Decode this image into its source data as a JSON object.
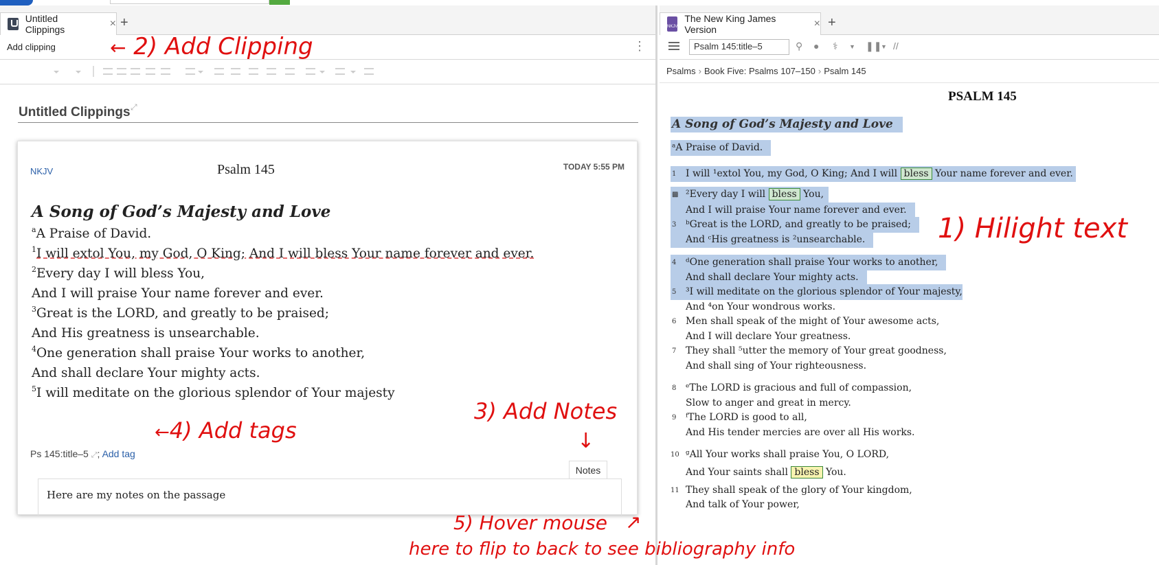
{
  "left": {
    "tab_title": "Untitled Clippings",
    "tab_close": "×",
    "tab_add": "+",
    "add_clipping": "Add clipping",
    "kebab": "⋮",
    "doc_title": "Untitled Clippings",
    "doc_title_edit": "⤢",
    "card": {
      "version": "NKJV",
      "reference": "Psalm 145",
      "timestamp": "TODAY 5:55 PM",
      "heading": "A Song of God’s Majesty and Love",
      "lines": [
        {
          "sup": "a",
          "text": "A Praise of David."
        },
        {
          "sup": "1",
          "text": "I will extol You, my God, O King; And I will bless Your name forever and ever."
        },
        {
          "sup": "2",
          "text": "Every day I will bless You,"
        },
        {
          "sup": "",
          "text": "And I will praise Your name forever and ever."
        },
        {
          "sup": "3",
          "text": "Great is the LORD, and greatly to be praised;"
        },
        {
          "sup": "",
          "text": "And His greatness is unsearchable."
        },
        {
          "sup": "4",
          "text": "One generation shall praise Your works to another,"
        },
        {
          "sup": "",
          "text": "And shall declare Your mighty acts."
        },
        {
          "sup": "5",
          "text": "I will meditate on the glorious splendor of Your majesty"
        }
      ],
      "tag_ref": "Ps 145:title–5",
      "tag_edit": "⤢",
      "tag_sep": "; ",
      "add_tag": "Add tag",
      "notes_tab": "Notes",
      "notes_text": "Here are my notes on the passage"
    }
  },
  "right": {
    "tab_title": "The New King James Version",
    "tab_close": "×",
    "tab_add": "+",
    "book_icon_text": "NKJV",
    "reference_input": "Psalm 145:title–5",
    "breadcrumb": [
      "Psalms",
      "Book Five: Psalms 107–150",
      "Psalm 145"
    ],
    "crumb_sep": "›",
    "psalm_title": "PSALM 145",
    "heading": "A Song of God’s Majesty and Love",
    "superscription": "ᵃA Praise of David.",
    "verses": [
      {
        "n": "1",
        "text_a": "I will ¹extol You, my God, O King; And I will ",
        "bless": "bless",
        "text_b": " Your name forever and ever."
      },
      {
        "n": "",
        "text_a": "²Every day I will ",
        "bless": "bless",
        "text_b": " You,"
      },
      {
        "n": "",
        "text_a": "And I will praise Your name forever and ever.",
        "bless": "",
        "text_b": ""
      },
      {
        "n": "3",
        "text_a": "ᵇGreat is the LORD, and greatly to be praised;",
        "bless": "",
        "text_b": ""
      },
      {
        "n": "",
        "text_a": "And ᶜHis greatness is ²unsearchable.",
        "bless": "",
        "text_b": ""
      },
      {
        "n": "4",
        "text_a": "ᵈOne generation shall praise Your works to another,",
        "bless": "",
        "text_b": ""
      },
      {
        "n": "",
        "text_a": "And shall declare Your mighty acts.",
        "bless": "",
        "text_b": ""
      },
      {
        "n": "5",
        "text_a": "³I will meditate on the glorious splendor of Your majesty,",
        "bless": "",
        "text_b": ""
      },
      {
        "n": "",
        "text_a": "And ⁴on Your wondrous works.",
        "bless": "",
        "text_b": ""
      },
      {
        "n": "6",
        "text_a": "Men shall speak of the might of Your awesome acts,",
        "bless": "",
        "text_b": ""
      },
      {
        "n": "",
        "text_a": "And I will declare Your greatness.",
        "bless": "",
        "text_b": ""
      },
      {
        "n": "7",
        "text_a": "They shall ⁵utter the memory of Your great goodness,",
        "bless": "",
        "text_b": ""
      },
      {
        "n": "",
        "text_a": "And shall sing of Your righteousness.",
        "bless": "",
        "text_b": ""
      },
      {
        "n": "8",
        "text_a": "ᵉThe LORD is gracious and full of compassion,",
        "bless": "",
        "text_b": ""
      },
      {
        "n": "",
        "text_a": "Slow to anger and great in mercy.",
        "bless": "",
        "text_b": ""
      },
      {
        "n": "9",
        "text_a": "ᶠThe LORD is good to all,",
        "bless": "",
        "text_b": ""
      },
      {
        "n": "",
        "text_a": "And His tender mercies are over all His works.",
        "bless": "",
        "text_b": ""
      },
      {
        "n": "10",
        "text_a": "ᵍAll Your works shall praise You, O LORD,",
        "bless": "",
        "text_b": ""
      },
      {
        "n": "",
        "text_a": "And Your saints shall ",
        "bless": "bless",
        "text_b": " You."
      },
      {
        "n": "11",
        "text_a": "They shall speak of the glory of Your kingdom,",
        "bless": "",
        "text_b": ""
      },
      {
        "n": "",
        "text_a": "And talk of Your power,",
        "bless": "",
        "text_b": ""
      }
    ]
  },
  "annotations": {
    "a1": "1) Hilight text",
    "a2": "2) Add Clipping",
    "a3": "3) Add Notes",
    "a4": "4) Add tags",
    "a5a": "5) Hover mouse",
    "a5b": "here to flip to back to see bibliography info"
  },
  "colors": {
    "highlight": "#b8cde8",
    "annotation": "#e01010",
    "link": "#2a5fa8"
  }
}
